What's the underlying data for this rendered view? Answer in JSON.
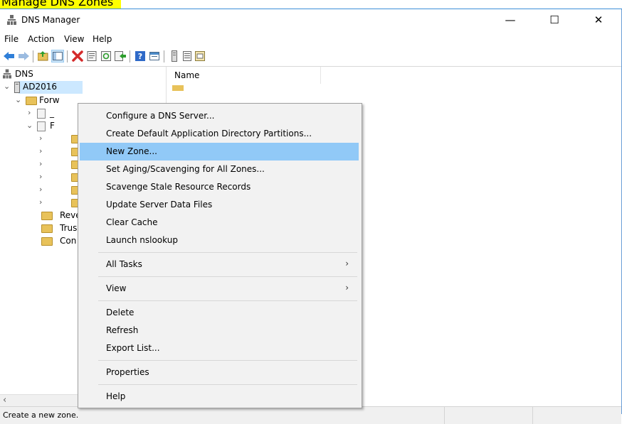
{
  "stray": {
    "text": "Manage DNS Zones"
  },
  "window": {
    "title": "DNS Manager",
    "minimize_glyph": "—",
    "maximize_glyph": "☐",
    "close_glyph": "✕"
  },
  "menubar": {
    "items": [
      "File",
      "Action",
      "View",
      "Help"
    ]
  },
  "toolbar": {
    "icons": [
      "back-icon",
      "forward-icon",
      "up-level-icon",
      "show-hide-tree-icon",
      "delete-icon",
      "properties-icon",
      "refresh-icon",
      "export-icon",
      "help-icon",
      "console-icon",
      "server-icon",
      "list-icon",
      "zone-icon"
    ]
  },
  "tree": {
    "root": "DNS",
    "server": "AD2016",
    "forward": "Forw",
    "zone1": "_",
    "zone2": "F",
    "reverse": "Reve",
    "trust": "Trus",
    "conditional": "Con"
  },
  "list": {
    "column_name": "Name"
  },
  "status": {
    "text": "Create a new zone."
  },
  "context_menu": {
    "items": [
      {
        "label": "Configure a DNS Server..."
      },
      {
        "label": "Create Default Application Directory Partitions..."
      },
      {
        "label": "New Zone...",
        "highlighted": true
      },
      {
        "label": "Set Aging/Scavenging for All Zones..."
      },
      {
        "label": "Scavenge Stale Resource Records"
      },
      {
        "label": "Update Server Data Files"
      },
      {
        "label": "Clear Cache"
      },
      {
        "label": "Launch nslookup"
      },
      {
        "label": "All Tasks",
        "submenu": true
      },
      {
        "label": "View",
        "submenu": true
      },
      {
        "label": "Delete"
      },
      {
        "label": "Refresh"
      },
      {
        "label": "Export List..."
      },
      {
        "label": "Properties"
      },
      {
        "label": "Help"
      }
    ]
  },
  "colors": {
    "highlight": "#91c9f7",
    "selection": "#cce8ff",
    "folder": "#e8c25a",
    "stray_highlight": "#ffff00"
  }
}
